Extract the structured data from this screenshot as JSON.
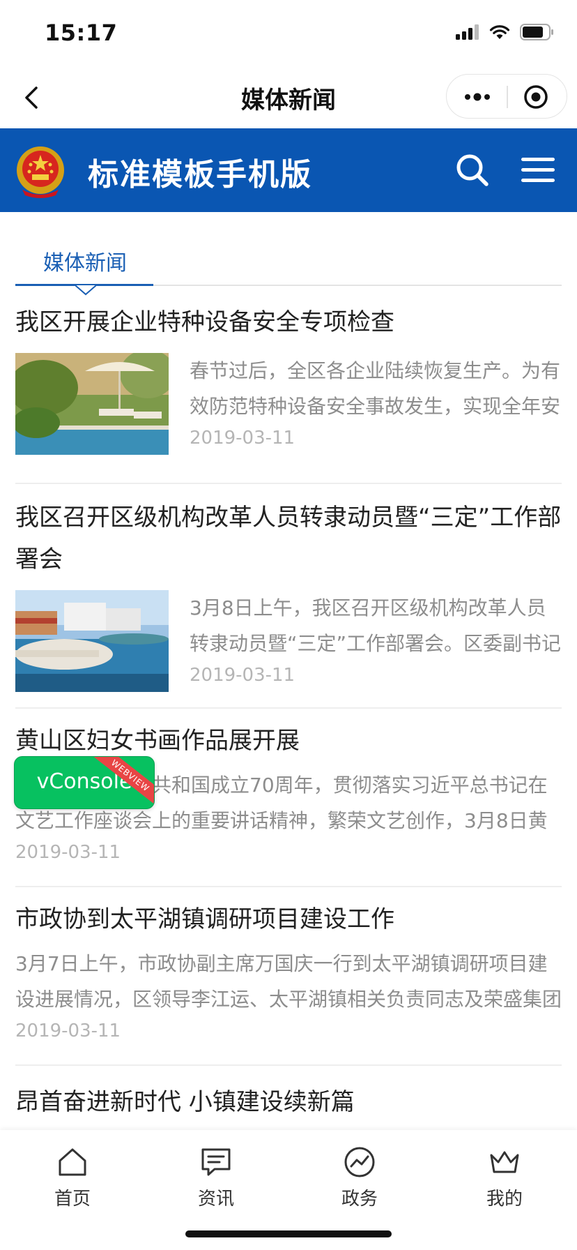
{
  "status_bar": {
    "time": "15:17"
  },
  "mp_nav": {
    "title": "媒体新闻"
  },
  "site_header": {
    "title": "标准模板手机版",
    "background_color": "#0a56b2"
  },
  "section_tab": {
    "label": "媒体新闻",
    "accent_color": "#1a5fb4"
  },
  "news": [
    {
      "title": "我区开展企业特种设备安全专项检查",
      "summary": "春节过后，全区各企业陆续恢复生产。为有效防范特种设备安全事故发生，实现全年安",
      "date": "2019-03-11",
      "thumbnail": "resort-pool-umbrella"
    },
    {
      "title": "我区召开区级机构改革人员转隶动员暨“三定”工作部署会",
      "summary": "3月8日上午，我区召开区级机构改革人员转隶动员暨“三定”工作部署会。区委副书记",
      "date": "2019-03-11",
      "thumbnail": "resort-pool-walkway"
    },
    {
      "title": "黄山区妇女书画作品展开展",
      "summary": "为庆祝中华人民共和国成立70周年，贯彻落实习近平总书记在文艺工作座谈会上的重要讲话精神，繁荣文艺创作，3月8日黄",
      "date": "2019-03-11"
    },
    {
      "title": "市政协到太平湖镇调研项目建设工作",
      "summary": "3月7日上午，市政协副主席万国庆一行到太平湖镇调研项目建设进展情况，区领导李江运、太平湖镇相关负责同志及荣盛集团",
      "date": "2019-03-11"
    },
    {
      "title": "昂首奋进新时代 小镇建设续新篇"
    }
  ],
  "vconsole": {
    "label": "vConsole",
    "ribbon": "WEBVIEW"
  },
  "tabbar": {
    "items": [
      {
        "label": "首页",
        "icon": "home-icon"
      },
      {
        "label": "资讯",
        "icon": "message-icon"
      },
      {
        "label": "政务",
        "icon": "trend-icon"
      },
      {
        "label": "我的",
        "icon": "crown-icon"
      }
    ]
  }
}
